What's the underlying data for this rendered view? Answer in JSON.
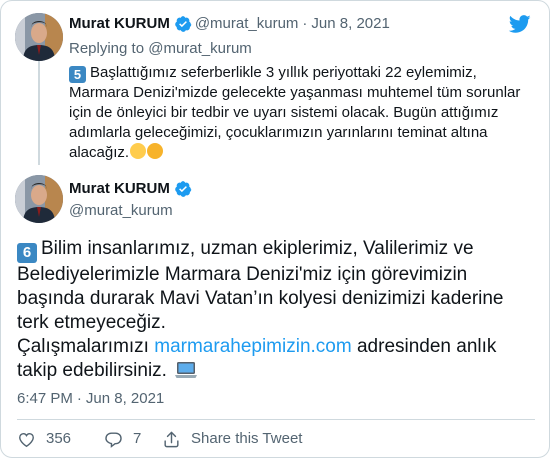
{
  "quoted_tweet": {
    "author_name": "Murat KURUM",
    "handle": "@murat_kurum",
    "separator": "·",
    "date": "Jun 8, 2021",
    "replying_prefix": "Replying to ",
    "replying_mention": "@murat_kurum",
    "number_emoji": "5",
    "lines": [
      "Başlattığımız seferberlikle 3 yıllık periyottaki 22 eylemimiz,",
      "Marmara Denizi'mizde gelecekte yaşanması muhtemel tüm sorunlar",
      "için de önleyici bir tedbir ve uyarı sistemi olacak. Bugün attığımız",
      "adımlarla geleceğimizi, çocuklarımızın yarınlarını teminat altına",
      "alacağız."
    ],
    "trailing_emojis": [
      "girl-emoji",
      "boy-emoji"
    ]
  },
  "main_tweet": {
    "author_name": "Murat KURUM",
    "handle": "@murat_kurum",
    "number_emoji": "6",
    "lines": [
      "Bilim insanlarımız, uzman ekiplerimiz, Valilerimiz ve",
      "Belediyelerimizle Marmara Denizi'miz için görevimizin",
      "başında durarak Mavi Vatan’ın kolyesi denizimizi kaderine",
      "terk etmeyeceğiz."
    ],
    "line5_prefix": "Çalışmalarımızı ",
    "link_text": "marmarahepimizin.com",
    "line5_suffix": " adresinden anlık",
    "line6": "takip edebilirsiniz.",
    "trailing_emoji": "laptop-emoji",
    "time": "6:47 PM",
    "separator": "·",
    "date": "Jun 8, 2021"
  },
  "actions": {
    "likes": "356",
    "replies": "7",
    "share_label": "Share this Tweet"
  },
  "colors": {
    "accent": "#1d9bf0",
    "muted": "#536471",
    "border": "#cfd9de",
    "like_icon": "#536471"
  },
  "icons": {
    "brand": "twitter-bird-icon",
    "verified": "verified-badge-icon",
    "like": "heart-icon",
    "reply": "reply-bubble-icon",
    "share": "share-arrow-icon"
  }
}
